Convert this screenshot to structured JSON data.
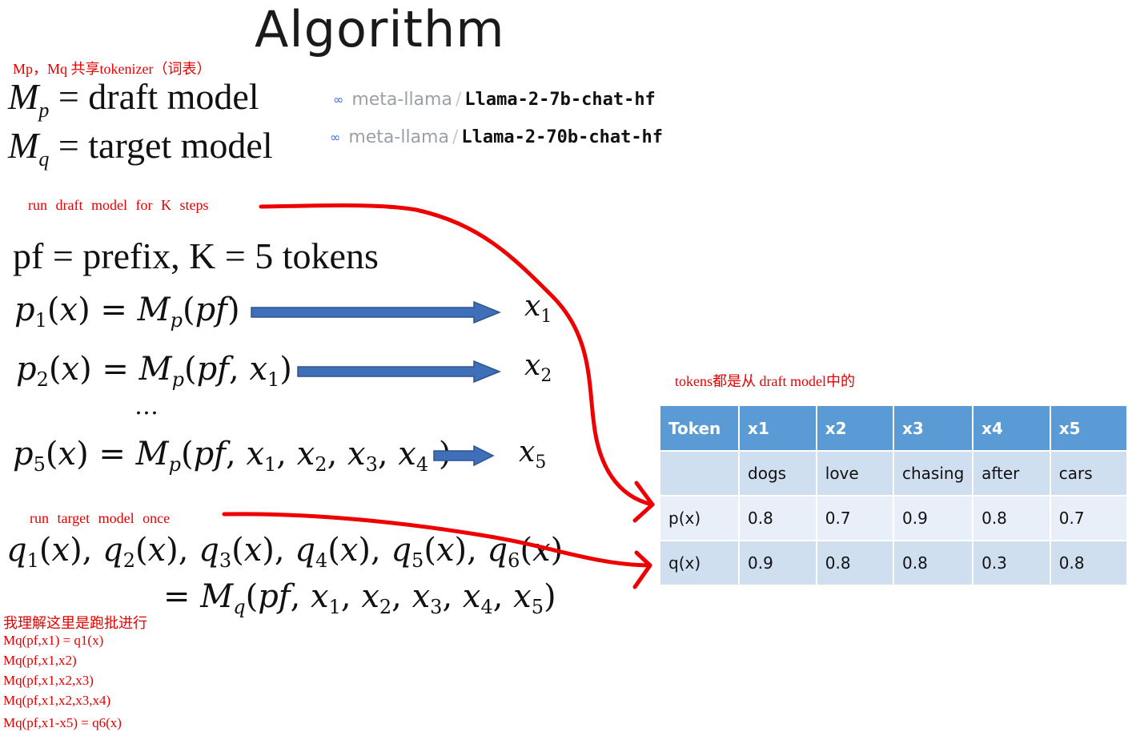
{
  "title": "Algorithm",
  "notes": {
    "shared_tokenizer": "Mp，Mq 共享tokenizer（词表）",
    "run_draft": "run draft model for K steps",
    "tokens_from_draft": "tokens都是从 draft model中的",
    "run_target": "run target model once",
    "batch_understanding": "我理解这里是跑批进行",
    "batch_lines": [
      "Mq(pf,x1) = q1(x)",
      "Mq(pf,x1,x2)",
      "Mq(pf,x1,x2,x3)",
      "Mq(pf,x1,x2,x3,x4)",
      "Mq(pf,x1-x5) = q6(x)"
    ]
  },
  "models": {
    "draft": {
      "sym": "M",
      "sub": "p",
      "rest": "= draft model"
    },
    "target": {
      "sym": "M",
      "sub": "q",
      "rest": "= target model"
    }
  },
  "hf_repos": [
    {
      "icon": "∞",
      "org": "meta-llama",
      "repo": "Llama-2-7b-chat-hf"
    },
    {
      "icon": "∞",
      "org": "meta-llama",
      "repo": "Llama-2-70b-chat-hf"
    }
  ],
  "equations": {
    "prefix": "pf = prefix, K = 5 tokens",
    "ellipsis": "…"
  },
  "table": {
    "headers": [
      "Token",
      "x1",
      "x2",
      "x3",
      "x4",
      "x5"
    ],
    "rows": [
      [
        "",
        "dogs",
        "love",
        "chasing",
        "after",
        "cars"
      ],
      [
        "p(x)",
        "0.8",
        "0.7",
        "0.9",
        "0.8",
        "0.7"
      ],
      [
        "q(x)",
        "0.9",
        "0.8",
        "0.8",
        "0.3",
        "0.8"
      ]
    ]
  },
  "colors": {
    "annotation": "#e60000",
    "arrow_blue": "#3f6fb8",
    "table_header": "#5b9bd5"
  }
}
